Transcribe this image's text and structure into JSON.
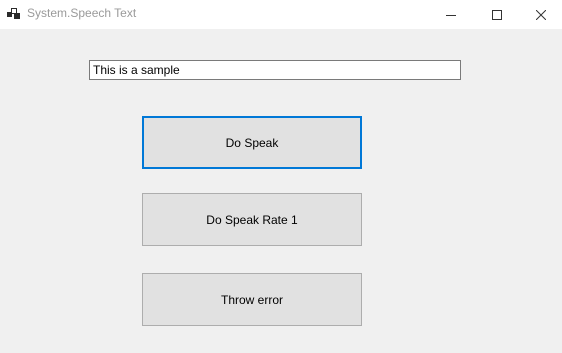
{
  "window": {
    "title": "System.Speech Text",
    "icons": {
      "app": "app-icon",
      "minimize": "minimize-icon",
      "maximize": "maximize-icon",
      "close": "close-icon"
    }
  },
  "form": {
    "text_input_value": "This is a sample",
    "buttons": {
      "speak": "Do Speak",
      "speak_rate": "Do Speak Rate 1",
      "throw_error": "Throw error"
    }
  },
  "colors": {
    "background": "#f0f0f0",
    "titlebar": "#ffffff",
    "button": "#e1e1e1",
    "focus_border": "#0078d7"
  }
}
